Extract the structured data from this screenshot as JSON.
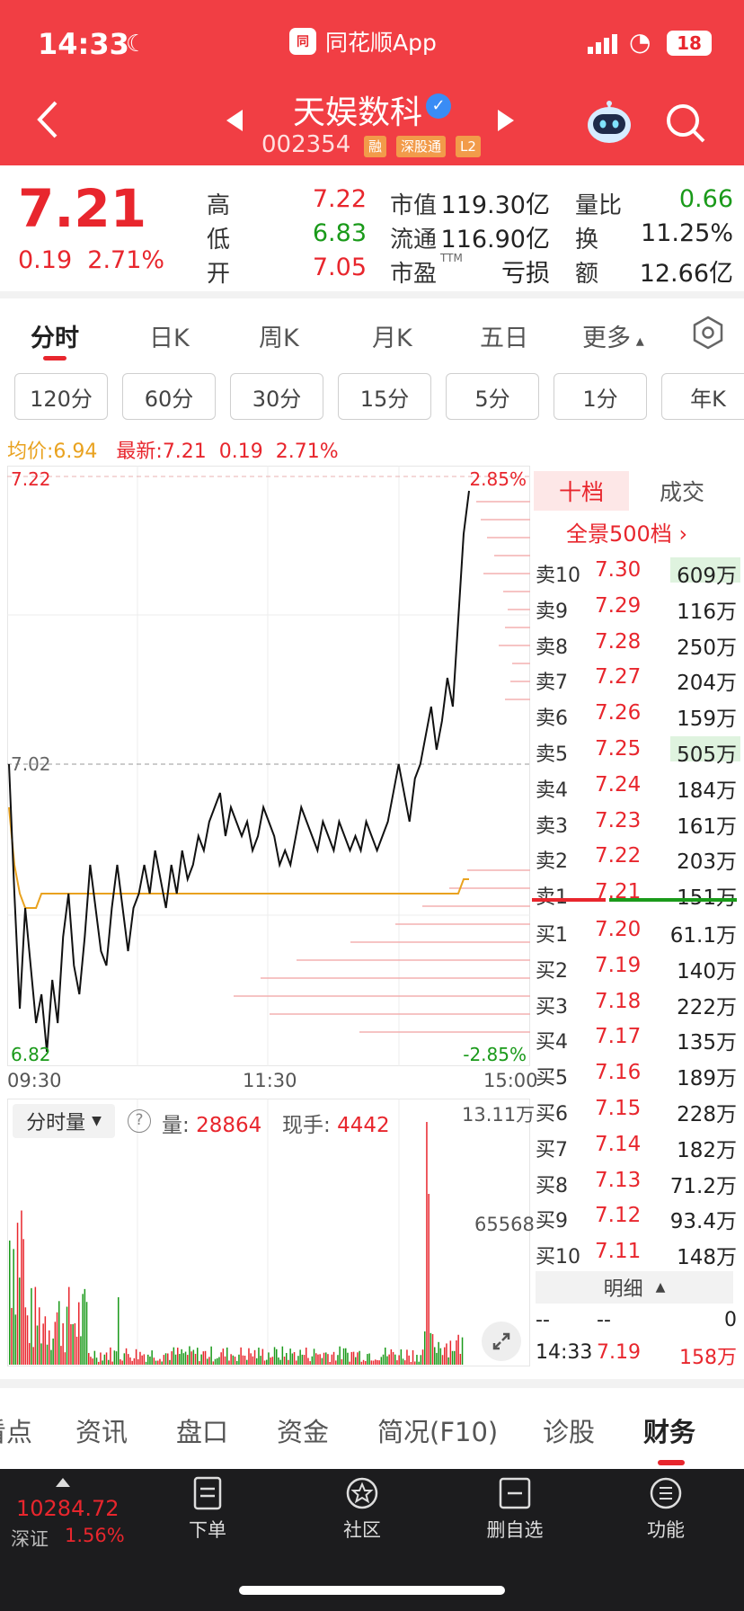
{
  "status_bar": {
    "time": "14:33",
    "app_name": "同花顺App",
    "battery": "18"
  },
  "stock": {
    "name": "天娱数科",
    "code": "002354",
    "tags": [
      "融",
      "深股通",
      "L2"
    ]
  },
  "quote": {
    "price": "7.21",
    "change": "0.19",
    "change_pct": "2.71%",
    "fields": [
      {
        "label": "高",
        "value": "7.22",
        "color": "#e8262d"
      },
      {
        "label": "低",
        "value": "6.83",
        "color": "#1a9a1a"
      },
      {
        "label": "开",
        "value": "7.05",
        "color": "#e8262d"
      },
      {
        "label": "市值",
        "value": "119.30亿",
        "color": "#222222"
      },
      {
        "label": "流通",
        "value": "116.90亿",
        "color": "#222222"
      },
      {
        "label": "市盈",
        "sup": "TTM",
        "value": "亏损",
        "color": "#222222"
      },
      {
        "label": "量比",
        "value": "0.66",
        "color": "#1a9a1a"
      },
      {
        "label": "换",
        "value": "11.25%",
        "color": "#222222"
      },
      {
        "label": "额",
        "value": "12.66亿",
        "color": "#222222"
      }
    ]
  },
  "chart_tabs": [
    "分时",
    "日K",
    "周K",
    "月K",
    "五日",
    "更多"
  ],
  "period_buttons": [
    "120分",
    "60分",
    "30分",
    "15分",
    "5分",
    "1分",
    "年K"
  ],
  "info_line": {
    "avg_label": "均价:",
    "avg": "6.94",
    "latest_label": "最新:",
    "latest": "7.21",
    "change": "0.19",
    "pct": "2.71%"
  },
  "chart_data": {
    "type": "line",
    "x_ticks": [
      "09:30",
      "11:30",
      "15:00"
    ],
    "y_top": "7.22",
    "y_mid": "7.02",
    "y_bottom": "6.82",
    "pct_top": "2.85%",
    "pct_bottom": "-2.85%",
    "ylim": [
      6.82,
      7.22
    ],
    "price": [
      7.02,
      6.93,
      6.85,
      6.92,
      6.88,
      6.84,
      6.86,
      6.82,
      6.87,
      6.84,
      6.9,
      6.93,
      6.88,
      6.86,
      6.9,
      6.95,
      6.92,
      6.89,
      6.88,
      6.92,
      6.95,
      6.92,
      6.89,
      6.92,
      6.93,
      6.95,
      6.93,
      6.96,
      6.94,
      6.92,
      6.95,
      6.93,
      6.96,
      6.94,
      6.95,
      6.97,
      6.96,
      6.98,
      6.99,
      7.0,
      6.97,
      6.99,
      6.98,
      6.97,
      6.98,
      6.96,
      6.97,
      6.99,
      6.98,
      6.97,
      6.95,
      6.96,
      6.95,
      6.97,
      6.99,
      6.98,
      6.97,
      6.96,
      6.98,
      6.97,
      6.96,
      6.98,
      6.97,
      6.96,
      6.97,
      6.96,
      6.98,
      6.97,
      6.96,
      6.97,
      6.98,
      7.0,
      7.02,
      7.0,
      6.98,
      7.01,
      7.02,
      7.04,
      7.06,
      7.03,
      7.05,
      7.08,
      7.06,
      7.12,
      7.18,
      7.21
    ],
    "avg": [
      6.99,
      6.95,
      6.93,
      6.92,
      6.92,
      6.92,
      6.93,
      6.93,
      6.93,
      6.93,
      6.93,
      6.93,
      6.93,
      6.93,
      6.93,
      6.93,
      6.93,
      6.93,
      6.93,
      6.93,
      6.93,
      6.93,
      6.93,
      6.93,
      6.93,
      6.93,
      6.93,
      6.93,
      6.93,
      6.93,
      6.93,
      6.93,
      6.93,
      6.93,
      6.93,
      6.93,
      6.93,
      6.93,
      6.93,
      6.93,
      6.93,
      6.93,
      6.93,
      6.93,
      6.93,
      6.93,
      6.93,
      6.93,
      6.93,
      6.93,
      6.93,
      6.93,
      6.93,
      6.93,
      6.93,
      6.93,
      6.93,
      6.93,
      6.93,
      6.93,
      6.93,
      6.93,
      6.93,
      6.93,
      6.93,
      6.93,
      6.93,
      6.93,
      6.93,
      6.93,
      6.93,
      6.93,
      6.93,
      6.93,
      6.93,
      6.93,
      6.93,
      6.93,
      6.93,
      6.93,
      6.93,
      6.93,
      6.93,
      6.93,
      6.94,
      6.94
    ]
  },
  "volume": {
    "selector": "分时量",
    "amount_label": "量:",
    "amount": "28864",
    "hand_label": "现手:",
    "hand": "4442",
    "max_label": "13.11万",
    "mid_label": "65568"
  },
  "orderbook": {
    "tab_ten": "十档",
    "tab_deal": "成交",
    "full_link": "全景500档",
    "sells": [
      {
        "label": "卖10",
        "price": "7.30",
        "vol": "609万",
        "hl": 0.3
      },
      {
        "label": "卖9",
        "price": "7.29",
        "vol": "116万",
        "hl": 0.06
      },
      {
        "label": "卖8",
        "price": "7.28",
        "vol": "250万",
        "hl": 0.12
      },
      {
        "label": "卖7",
        "price": "7.27",
        "vol": "204万",
        "hl": 0.1
      },
      {
        "label": "卖6",
        "price": "7.26",
        "vol": "159万",
        "hl": 0.08
      },
      {
        "label": "卖5",
        "price": "7.25",
        "vol": "505万",
        "hl": 0.25
      },
      {
        "label": "卖4",
        "price": "7.24",
        "vol": "184万",
        "hl": 0.09
      },
      {
        "label": "卖3",
        "price": "7.23",
        "vol": "161万",
        "hl": 0.08
      },
      {
        "label": "卖2",
        "price": "7.22",
        "vol": "203万",
        "hl": 0.1
      },
      {
        "label": "卖1",
        "price": "7.21",
        "vol": "151万",
        "hl": 0.07
      }
    ],
    "buys": [
      {
        "label": "买1",
        "price": "7.20",
        "vol": "61.1万",
        "hl": 0.03
      },
      {
        "label": "买2",
        "price": "7.19",
        "vol": "140万",
        "hl": 0.07
      },
      {
        "label": "买3",
        "price": "7.18",
        "vol": "222万",
        "hl": 0.11
      },
      {
        "label": "买4",
        "price": "7.17",
        "vol": "135万",
        "hl": 0.07
      },
      {
        "label": "买5",
        "price": "7.16",
        "vol": "189万",
        "hl": 0.09
      },
      {
        "label": "买6",
        "price": "7.15",
        "vol": "228万",
        "hl": 0.11
      },
      {
        "label": "买7",
        "price": "7.14",
        "vol": "182万",
        "hl": 0.09
      },
      {
        "label": "买8",
        "price": "7.13",
        "vol": "71.2万",
        "hl": 0.03
      },
      {
        "label": "买9",
        "price": "7.12",
        "vol": "93.4万",
        "hl": 0.05
      },
      {
        "label": "买10",
        "price": "7.11",
        "vol": "148万",
        "hl": 0.07
      }
    ],
    "detail_label": "明细",
    "trades": [
      {
        "time": "--",
        "price": "--",
        "vol": "0"
      },
      {
        "time": "14:33",
        "price": "7.19",
        "vol": "158万"
      }
    ]
  },
  "info_tabs": [
    "看点",
    "资讯",
    "盘口",
    "资金",
    "简况(F10)",
    "诊股",
    "财务"
  ],
  "bottom_bar": {
    "index_value": "10284.72",
    "index_name": "深证",
    "index_pct": "1.56%",
    "items": [
      "下单",
      "社区",
      "删自选",
      "功能"
    ]
  },
  "colors": {
    "header_red": "#f13e44",
    "up_red": "#e8262d",
    "down_green": "#1a9a1a",
    "avg_orange": "#e9a21f"
  }
}
